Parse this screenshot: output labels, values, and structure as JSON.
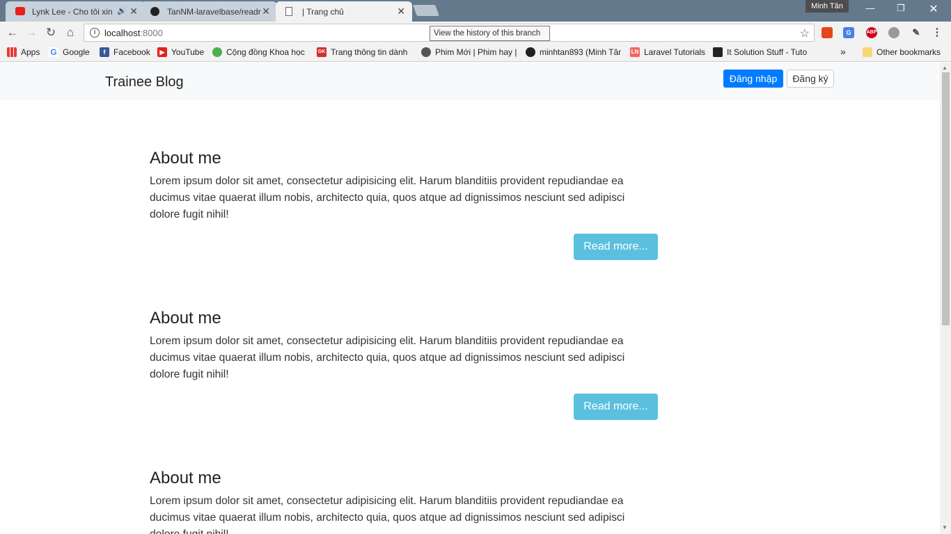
{
  "browser": {
    "tabs": [
      {
        "title": "Lynk Lee - Cho tôi xin",
        "favicon": "youtube-icon",
        "audio": "speaker-icon"
      },
      {
        "title": "TanNM-laravelbase/readr",
        "favicon": "github-icon"
      },
      {
        "title": "| Trang chủ",
        "favicon": "page-icon"
      }
    ],
    "profile_name": "Minh Tân",
    "url_host": "localhost",
    "url_port": ":8000",
    "tooltip": "View the history of this branch",
    "bookmarks": [
      {
        "label": "Apps",
        "icon": "apps-grid-icon"
      },
      {
        "label": "Google",
        "icon": "google-icon"
      },
      {
        "label": "Facebook",
        "icon": "facebook-icon"
      },
      {
        "label": "YouTube",
        "icon": "youtube-icon"
      },
      {
        "label": "Cộng đồng Khoa học",
        "icon": "leaf-icon"
      },
      {
        "label": "Trang thông tin dành",
        "icon": "gk-icon"
      },
      {
        "label": "Phim Mới | Phim hay |",
        "icon": "film-reel-icon"
      },
      {
        "label": "minhtan893 (Minh Tân",
        "icon": "github-icon"
      },
      {
        "label": "Laravel Tutorials",
        "icon": "ln-icon"
      },
      {
        "label": "It Solution Stuff - Tuto",
        "icon": "its-icon"
      }
    ],
    "overflow": "»",
    "other_bookmarks": "Other bookmarks"
  },
  "site": {
    "brand": "Trainee Blog",
    "login": "Đăng nhập",
    "register": "Đăng ký",
    "posts": [
      {
        "title": "About me",
        "body": "Lorem ipsum dolor sit amet, consectetur adipisicing elit. Harum blanditiis provident repudiandae ea ducimus vitae quaerat illum nobis, architecto quia, quos atque ad dignissimos nesciunt sed adipisci dolore fugit nihil!",
        "more": "Read more..."
      },
      {
        "title": "About me",
        "body": "Lorem ipsum dolor sit amet, consectetur adipisicing elit. Harum blanditiis provident repudiandae ea ducimus vitae quaerat illum nobis, architecto quia, quos atque ad dignissimos nesciunt sed adipisci dolore fugit nihil!",
        "more": "Read more..."
      },
      {
        "title": "About me",
        "body": "Lorem ipsum dolor sit amet, consectetur adipisicing elit. Harum blanditiis provident repudiandae ea ducimus vitae quaerat illum nobis, architecto quia, quos atque ad dignissimos nesciunt sed adipisci dolore fugit nihil!"
      }
    ]
  },
  "colors": {
    "primary": "#007bff",
    "info": "#5bc0de",
    "navbar_bg": "#f8f9fa"
  }
}
